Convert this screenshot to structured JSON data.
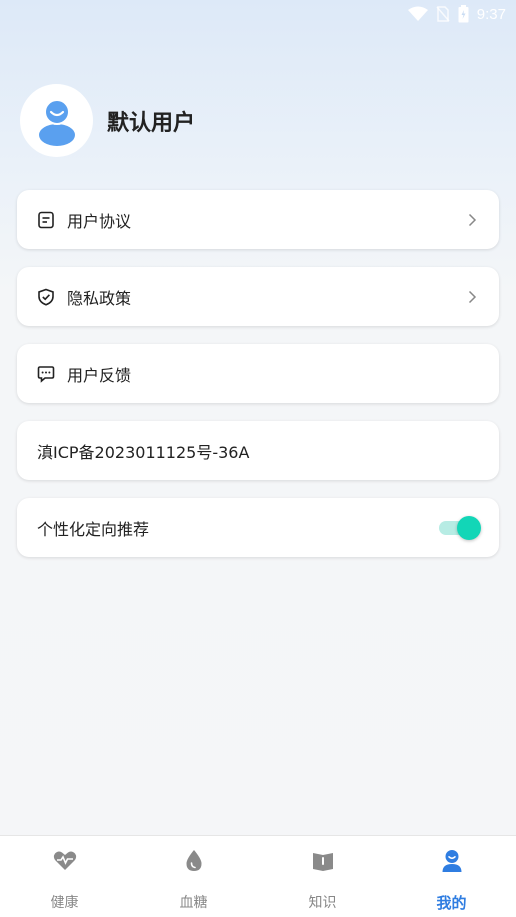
{
  "status_bar": {
    "time": "9:37"
  },
  "profile": {
    "username": "默认用户"
  },
  "menu": {
    "user_agreement": "用户协议",
    "privacy_policy": "隐私政策",
    "feedback": "用户反馈",
    "icp": "滇ICP备2023011125号-36A",
    "personalized": "个性化定向推荐",
    "personalized_enabled": true
  },
  "tabs": [
    {
      "label": "健康",
      "icon": "heart-pulse-icon"
    },
    {
      "label": "血糖",
      "icon": "blood-drop-icon"
    },
    {
      "label": "知识",
      "icon": "book-icon"
    },
    {
      "label": "我的",
      "icon": "user-icon",
      "active": true
    }
  ],
  "colors": {
    "accent": "#2f7de1",
    "toggle_on": "#12d6b7",
    "avatar": "#5aa0ef"
  }
}
